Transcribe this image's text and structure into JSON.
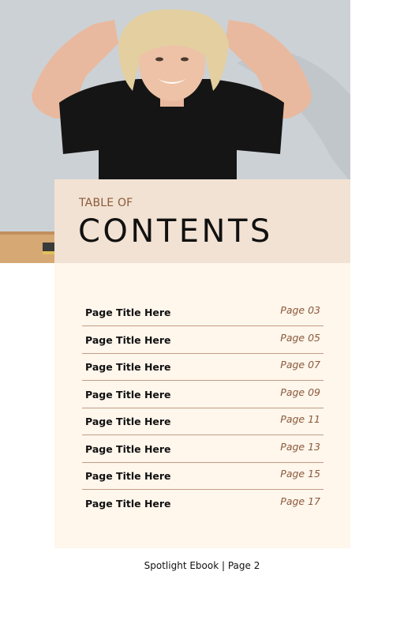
{
  "header": {
    "kicker": "TABLE OF",
    "title": "CONTENTS"
  },
  "toc": {
    "items": [
      {
        "title": "Page Title Here",
        "page": "Page 03"
      },
      {
        "title": "Page Title Here",
        "page": "Page 05"
      },
      {
        "title": "Page Title Here",
        "page": "Page 07"
      },
      {
        "title": "Page Title Here",
        "page": "Page 09"
      },
      {
        "title": "Page Title Here",
        "page": "Page 11"
      },
      {
        "title": "Page Title Here",
        "page": "Page 13"
      },
      {
        "title": "Page Title Here",
        "page": "Page 15"
      },
      {
        "title": "Page Title Here",
        "page": "Page 17"
      }
    ]
  },
  "footer": {
    "text": "Spotlight Ebook | Page 2"
  },
  "colors": {
    "header_panel": "#f2e2d3",
    "list_panel": "#fff6ec",
    "accent_brown": "#8a5a3b",
    "divider": "#c19e84"
  }
}
